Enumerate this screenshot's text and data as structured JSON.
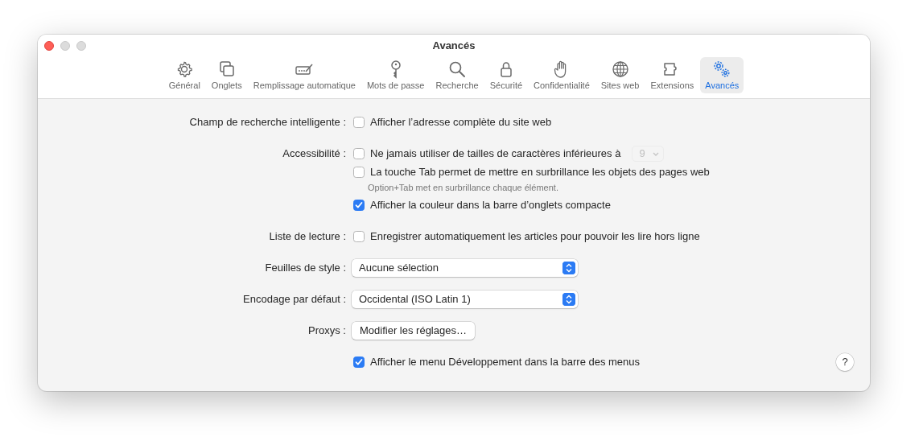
{
  "window": {
    "title": "Avancés"
  },
  "toolbar": [
    {
      "label": "Général",
      "selected": false
    },
    {
      "label": "Onglets",
      "selected": false
    },
    {
      "label": "Remplissage automatique",
      "selected": false
    },
    {
      "label": "Mots de passe",
      "selected": false
    },
    {
      "label": "Recherche",
      "selected": false
    },
    {
      "label": "Sécurité",
      "selected": false
    },
    {
      "label": "Confidentialité",
      "selected": false
    },
    {
      "label": "Sites web",
      "selected": false
    },
    {
      "label": "Extensions",
      "selected": false
    },
    {
      "label": "Avancés",
      "selected": true
    }
  ],
  "settings": [
    {
      "label": "Champ de recherche intelligente :",
      "controls": [
        {
          "kind": "checkbox",
          "text": "Afficher l’adresse complète du site web",
          "checked": false
        }
      ]
    },
    {
      "label": "Accessibilité :",
      "controls": [
        {
          "kind": "checkbox",
          "text": "Ne jamais utiliser de tailles de caractères inférieures à",
          "checked": false,
          "size_popup": {
            "value": "9",
            "disabled": true
          }
        },
        {
          "kind": "checkbox",
          "text": "La touche Tab permet de mettre en surbrillance les objets des pages web",
          "checked": false
        },
        {
          "kind": "hint",
          "text": "Option+Tab met en surbrillance chaque élément."
        },
        {
          "kind": "checkbox",
          "text": "Afficher la couleur dans la barre d’onglets compacte",
          "checked": true
        }
      ]
    },
    {
      "label": "Liste de lecture :",
      "controls": [
        {
          "kind": "checkbox",
          "text": "Enregistrer automatiquement les articles pour pouvoir les lire hors ligne",
          "checked": false
        }
      ]
    },
    {
      "label": "Feuilles de style :",
      "controls": [
        {
          "kind": "popup",
          "text": "Aucune sélection"
        }
      ]
    },
    {
      "label": "Encodage par défaut :",
      "controls": [
        {
          "kind": "popup",
          "text": "Occidental (ISO Latin 1)"
        }
      ]
    },
    {
      "label": "Proxys :",
      "controls": [
        {
          "kind": "button",
          "text": "Modifier les réglages…"
        }
      ]
    },
    {
      "controls": [
        {
          "kind": "checkbox",
          "text": "Afficher le menu Développement dans la barre des menus",
          "checked": true
        }
      ]
    }
  ],
  "help_button": {
    "text": "?"
  }
}
